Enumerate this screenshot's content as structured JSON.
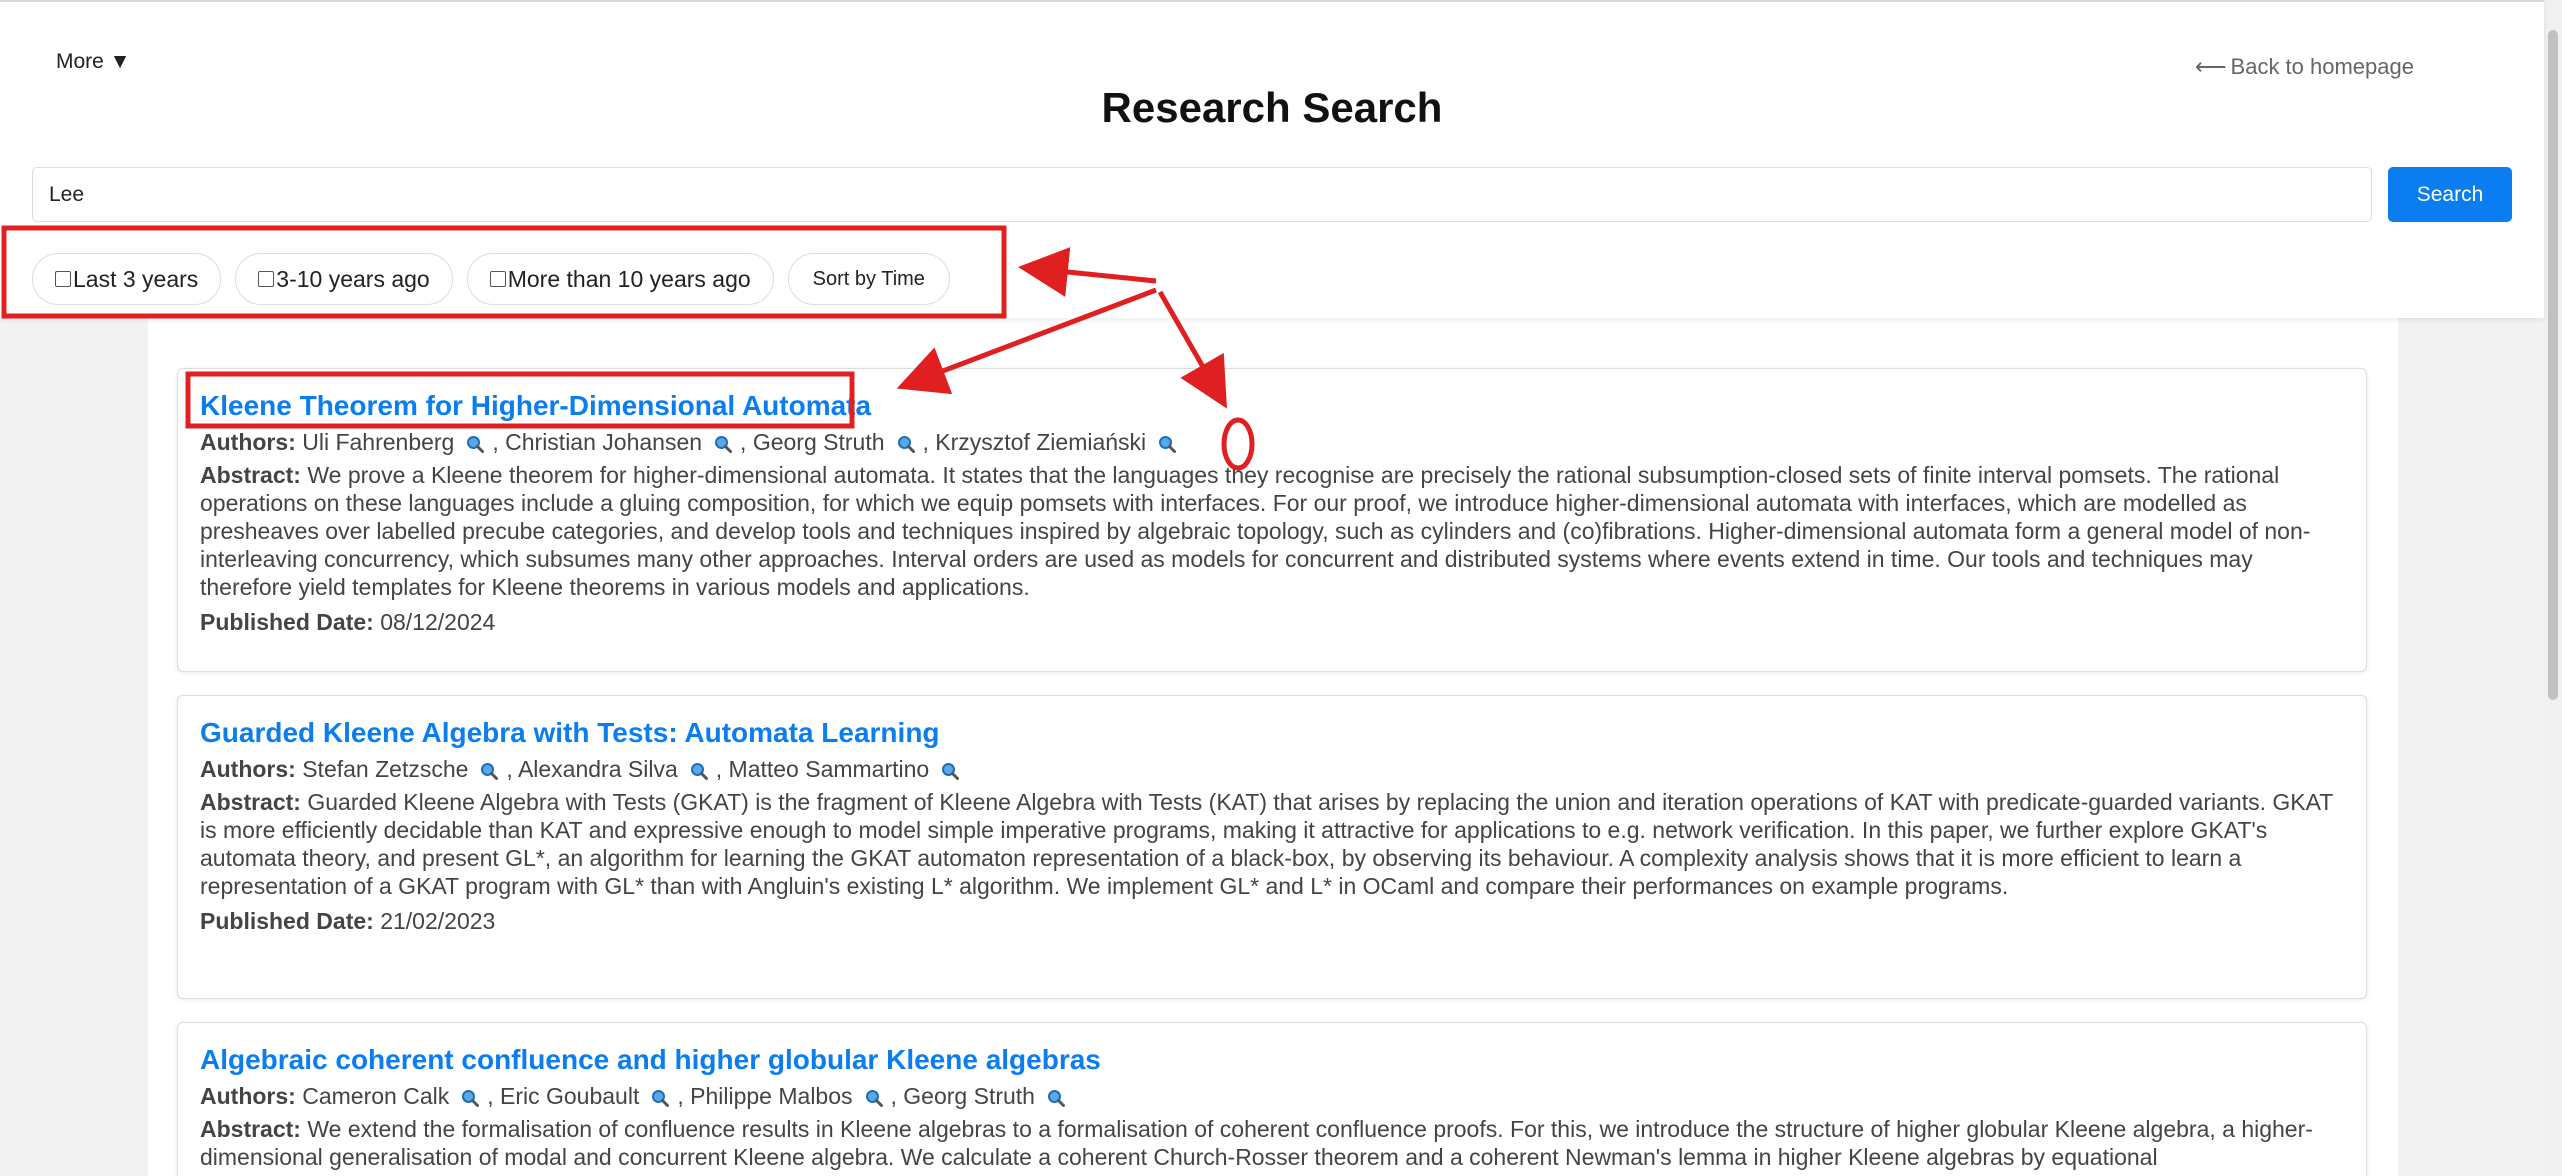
{
  "header": {
    "more_label": "More ▼",
    "back_label": "Back to homepage",
    "back_arrow": "⟵",
    "title": "Research Search"
  },
  "search": {
    "value": "Lee",
    "button_label": "Search"
  },
  "filters": {
    "last3": "Last 3 years",
    "mid": "3-10 years ago",
    "old": "More than 10 years ago",
    "sort": "Sort by Time"
  },
  "labels": {
    "authors": "Authors:",
    "abstract": "Abstract:",
    "published": "Published Date:"
  },
  "results": [
    {
      "title": "Kleene Theorem for Higher-Dimensional Automata",
      "authors": [
        "Uli Fahrenberg",
        "Christian Johansen",
        "Georg Struth",
        "Krzysztof Ziemiański"
      ],
      "abstract": "We prove a Kleene theorem for higher-dimensional automata. It states that the languages they recognise are precisely the rational subsumption-closed sets of finite interval pomsets. The rational operations on these languages include a gluing composition, for which we equip pomsets with interfaces. For our proof, we introduce higher-dimensional automata with interfaces, which are modelled as presheaves over labelled precube categories, and develop tools and techniques inspired by algebraic topology, such as cylinders and (co)fibrations. Higher-dimensional automata form a general model of non-interleaving concurrency, which subsumes many other approaches. Interval orders are used as models for concurrent and distributed systems where events extend in time. Our tools and techniques may therefore yield templates for Kleene theorems in various models and applications.",
      "date": "08/12/2024"
    },
    {
      "title": "Guarded Kleene Algebra with Tests: Automata Learning",
      "authors": [
        "Stefan Zetzsche",
        "Alexandra Silva",
        "Matteo Sammartino"
      ],
      "abstract": "Guarded Kleene Algebra with Tests (GKAT) is the fragment of Kleene Algebra with Tests (KAT) that arises by replacing the union and iteration operations of KAT with predicate-guarded variants. GKAT is more efficiently decidable than KAT and expressive enough to model simple imperative programs, making it attractive for applications to e.g. network verification. In this paper, we further explore GKAT's automata theory, and present GL*, an algorithm for learning the GKAT automaton representation of a black-box, by observing its behaviour. A complexity analysis shows that it is more efficient to learn a representation of a GKAT program with GL* than with Angluin's existing L* algorithm. We implement GL* and L* in OCaml and compare their performances on example programs.",
      "date": "21/02/2023"
    },
    {
      "title": "Algebraic coherent confluence and higher globular Kleene algebras",
      "authors": [
        "Cameron Calk",
        "Eric Goubault",
        "Philippe Malbos",
        "Georg Struth"
      ],
      "abstract": "We extend the formalisation of confluence results in Kleene algebras to a formalisation of coherent confluence proofs. For this, we introduce the structure of higher globular Kleene algebra, a higher-dimensional generalisation of modal and concurrent Kleene algebra. We calculate a coherent Church-Rosser theorem and a coherent Newman's lemma in higher Kleene algebras by equational",
      "date": ""
    }
  ],
  "annotation_color": "#e02020"
}
